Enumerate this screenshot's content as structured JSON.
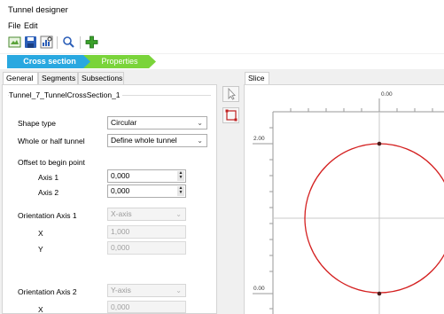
{
  "window": {
    "title": "Tunnel designer"
  },
  "menu": [
    {
      "label": "File"
    },
    {
      "label": "Edit"
    }
  ],
  "toolbar": {
    "buttons": [
      "new-icon",
      "save-icon",
      "chart-icon",
      "search-icon",
      "add-icon"
    ]
  },
  "wizard": {
    "steps": [
      {
        "label": "Cross section"
      },
      {
        "label": "Properties"
      }
    ]
  },
  "tabs": [
    {
      "label": "General"
    },
    {
      "label": "Segments"
    },
    {
      "label": "Subsections"
    }
  ],
  "general": {
    "group_title": "Tunnel_7_TunnelCrossSection_1",
    "shape_type": {
      "label": "Shape type",
      "value": "Circular"
    },
    "whole_half": {
      "label": "Whole or half tunnel",
      "value": "Define whole tunnel"
    },
    "offset": {
      "label": "Offset to begin point",
      "axis1": {
        "label": "Axis 1",
        "value": "0,000"
      },
      "axis2": {
        "label": "Axis 2",
        "value": "0,000"
      }
    },
    "orientation1": {
      "label": "Orientation Axis 1",
      "value": "X-axis",
      "x": {
        "label": "X",
        "value": "1,000"
      },
      "y": {
        "label": "Y",
        "value": "0,000"
      }
    },
    "orientation2": {
      "label": "Orientation Axis 2",
      "value": "Y-axis",
      "x": {
        "label": "X",
        "value": "0,000"
      }
    }
  },
  "slice": {
    "tab_label": "Slice",
    "ruler_top_label": "0.00",
    "ruler_left_labels": [
      "2.00",
      "0.00"
    ],
    "colors": {
      "circle": "#d42020",
      "ruler": "#9a9a9a",
      "guide": "#c8c8c8"
    }
  }
}
